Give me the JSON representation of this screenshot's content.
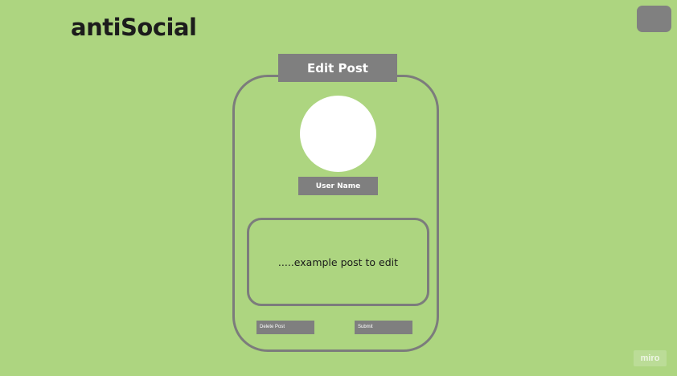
{
  "app": {
    "logo": "antiSocial"
  },
  "edit_post": {
    "title": "Edit Post",
    "user_name": "User Name",
    "post_text": ".....example post to edit",
    "delete_label": "Delete Post",
    "submit_label": "Submit"
  },
  "watermark": {
    "text": "miro"
  },
  "colors": {
    "background": "#add580",
    "panel_gray": "#7f7f7f",
    "border_gray": "#7c7c7c",
    "avatar": "#ffffff"
  }
}
